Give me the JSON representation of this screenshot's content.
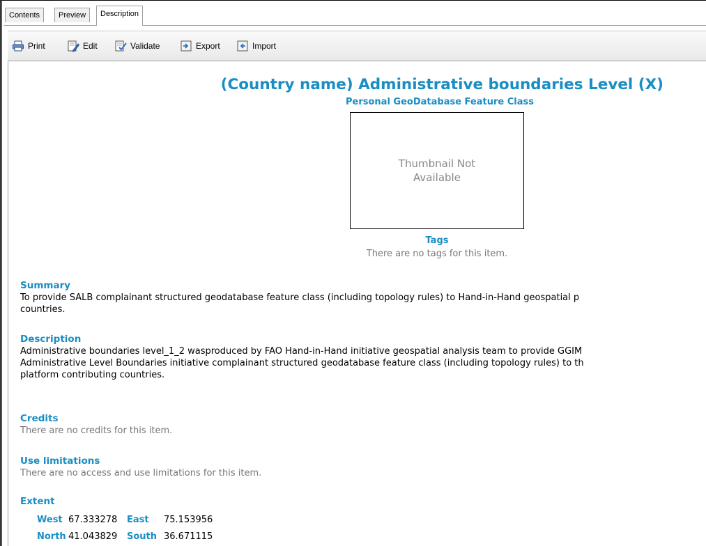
{
  "tabs": [
    {
      "label": "Contents"
    },
    {
      "label": "Preview"
    },
    {
      "label": "Description",
      "active": true
    }
  ],
  "toolbar": {
    "print": "Print",
    "edit": "Edit",
    "validate": "Validate",
    "export": "Export",
    "import": "Import"
  },
  "item": {
    "title": "(Country name) Administrative boundaries Level (X)",
    "subtitle": "Personal GeoDatabase Feature Class",
    "thumbnail_line1": "Thumbnail Not",
    "thumbnail_line2": "Available",
    "tags_label": "Tags",
    "tags_empty": "There are no tags for this item."
  },
  "sections": {
    "summary_h": "Summary",
    "summary_1": "To provide SALB complainant structured geodatabase feature class (including topology rules) to Hand-in-Hand geospatial p",
    "summary_2": "countries.",
    "description_h": "Description",
    "description_1": "Administrative boundaries level_1_2 wasproduced by FAO Hand-in-Hand initiative geospatial analysis team to provide GGIM",
    "description_2": "Administrative Level Boundaries initiative complainant structured geodatabase feature class (including topology rules) to th",
    "description_3": "platform contributing countries.",
    "credits_h": "Credits",
    "credits_t": "There are no credits for this item.",
    "use_h": "Use limitations",
    "use_t": "There are no access and use limitations for this item.",
    "extent_h": "Extent"
  },
  "extent": {
    "west_label": "West",
    "west": "67.333278",
    "east_label": "East",
    "east": "75.153956",
    "north_label": "North",
    "north": "41.043829",
    "south_label": "South",
    "south": "36.671115"
  },
  "colors": {
    "accent": "#1a8ec2",
    "muted": "#777777"
  }
}
